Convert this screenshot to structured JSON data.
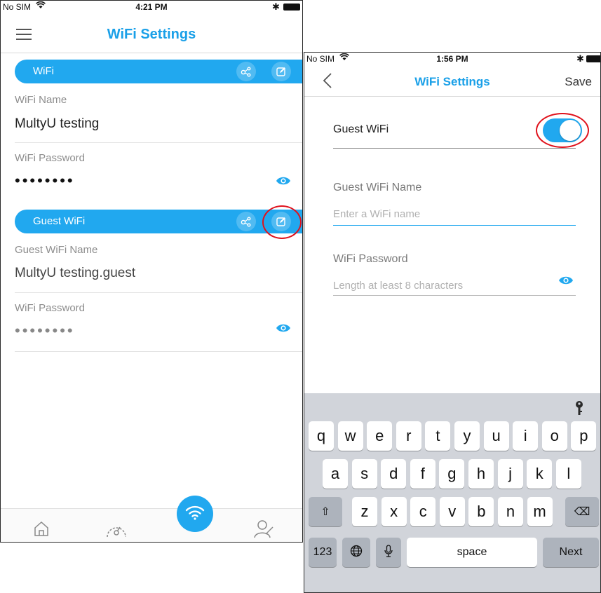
{
  "screen1": {
    "status": {
      "carrier": "No SIM",
      "time": "4:21 PM"
    },
    "header": {
      "title": "WiFi Settings"
    },
    "wifi_section": {
      "label": "WiFi",
      "name_label": "WiFi Name",
      "name_value": "MultyU testing",
      "password_label": "WiFi Password",
      "password_mask": "••••••••"
    },
    "guest_section": {
      "label": "Guest WiFi",
      "name_label": "Guest WiFi Name",
      "name_value": "MultyU testing.guest",
      "password_label": "WiFi Password",
      "password_mask": "••••••••"
    },
    "tabbar": [
      "home-icon",
      "speedometer-icon",
      "wifi-icon",
      "user-icon"
    ]
  },
  "screen2": {
    "status": {
      "carrier": "No SIM",
      "time": "1:56 PM"
    },
    "nav": {
      "title": "WiFi Settings",
      "save_label": "Save"
    },
    "guest_toggle": {
      "label": "Guest WiFi",
      "state": "on"
    },
    "guest_name": {
      "label": "Guest WiFi Name",
      "placeholder": "Enter a WiFi name"
    },
    "password": {
      "label": "WiFi Password",
      "placeholder": "Length at least 8 characters"
    },
    "keyboard": {
      "row1": [
        "q",
        "w",
        "e",
        "r",
        "t",
        "y",
        "u",
        "i",
        "o",
        "p"
      ],
      "row2": [
        "a",
        "s",
        "d",
        "f",
        "g",
        "h",
        "j",
        "k",
        "l"
      ],
      "row3": [
        "z",
        "x",
        "c",
        "v",
        "b",
        "n",
        "m"
      ],
      "numbers_label": "123",
      "space_label": "space",
      "next_label": "Next"
    }
  },
  "colors": {
    "accent": "#21a8ef",
    "highlight_ring": "#e0121c"
  }
}
